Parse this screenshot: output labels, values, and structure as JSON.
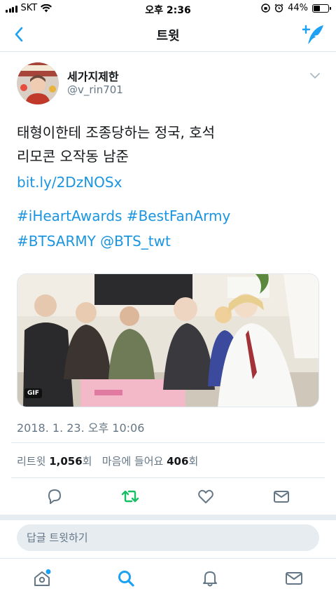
{
  "status_bar": {
    "carrier": "SKT",
    "time": "오후 2:36",
    "battery": "44%",
    "battery_level": 0.44
  },
  "nav": {
    "title": "트윗",
    "back_icon": "chevron-left-icon",
    "compose_icon": "compose-feather-icon"
  },
  "tweet": {
    "display_name": "세가지제한",
    "handle": "@v_rin701",
    "text_lines": [
      "태형이한테 조종당하는 정국, 호석",
      "리모콘 오작동 남준"
    ],
    "link": "bit.ly/2DzNOSx",
    "tag_lines": [
      "#iHeartAwards #BestFanArmy",
      "#BTSARMY @BTS_twt"
    ],
    "media_badge": "GIF",
    "timestamp": "2018. 1. 23. 오후 10:06",
    "stats": {
      "retweets_label": "리트윗",
      "retweets": "1,056",
      "retweets_unit": "회",
      "likes_label": "마음에 들어요",
      "likes": "406",
      "likes_unit": "회"
    }
  },
  "actions": [
    "reply-icon",
    "retweet-icon",
    "heart-icon",
    "direct-message-icon"
  ],
  "reply": {
    "placeholder": "답글 트윗하기"
  },
  "tabs": [
    "home-icon",
    "search-icon",
    "notifications-icon",
    "messages-icon"
  ],
  "colors": {
    "accent": "#1da1f2",
    "link": "#1b95e0",
    "retweet_active": "#17bf63",
    "muted": "#657786",
    "divider": "#e1e8ed",
    "background_band": "#e6ecf0"
  }
}
